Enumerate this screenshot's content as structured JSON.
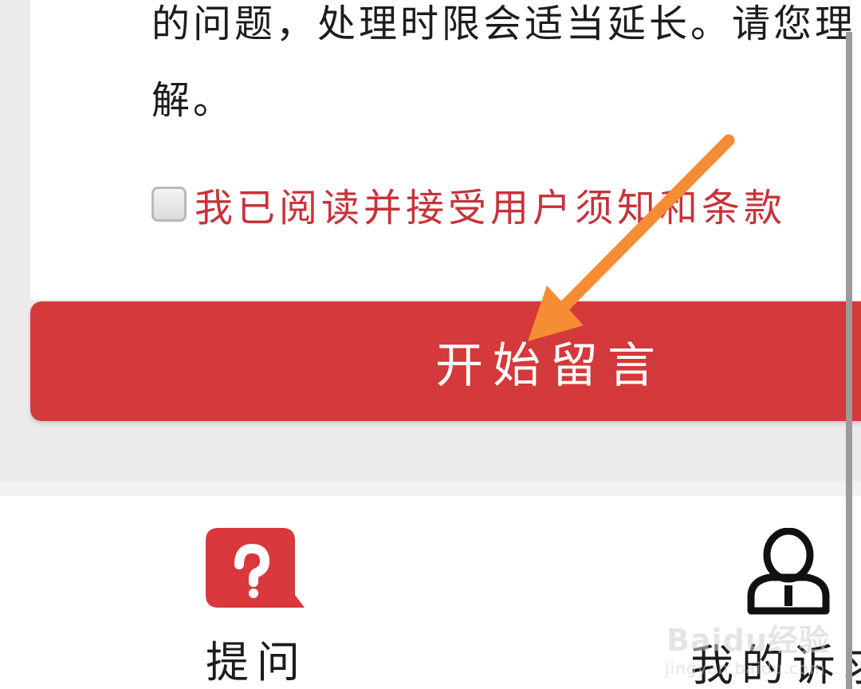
{
  "notice": {
    "lines": [
      "的问题，处理时限会适当延长。请您理",
      "解。"
    ]
  },
  "agreement": {
    "checked": false,
    "label": "我已阅读并接受用户须知和条款"
  },
  "start_button": {
    "label": "开始留言"
  },
  "tabbar": {
    "ask": {
      "label": "提问",
      "icon": "question-bubble-icon",
      "icon_color": "#d9383c"
    },
    "mine": {
      "label": "我的诉求",
      "icon": "user-icon"
    }
  },
  "annotation": {
    "arrow_color": "#f68d35"
  },
  "watermark": {
    "brand": "Baidu经验",
    "url": "jingyan.baidu.com"
  },
  "colors": {
    "accent": "#d4393b",
    "agreement_text": "#c8323a",
    "background": "#ebebeb"
  }
}
